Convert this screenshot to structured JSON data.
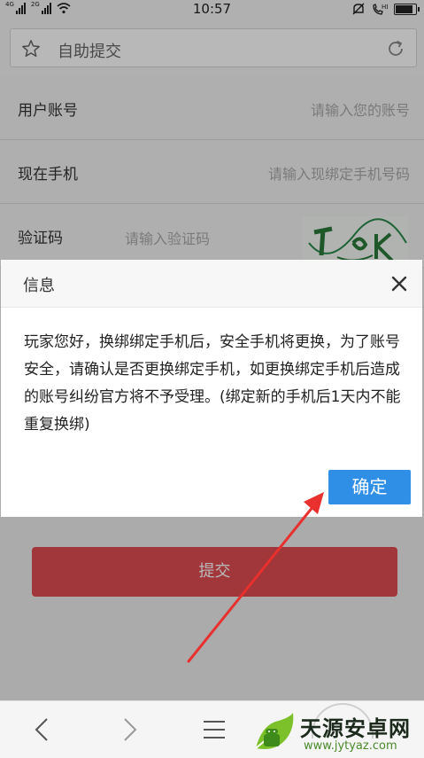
{
  "status_bar": {
    "signal_1": "4G",
    "signal_2": "2G",
    "time": "10:57",
    "battery_level": 0.85
  },
  "address_bar": {
    "title": "自助提交",
    "star_icon": "star-icon",
    "reload_icon": "reload-icon"
  },
  "form": {
    "rows": [
      {
        "label": "用户账号",
        "placeholder": "请输入您的账号"
      },
      {
        "label": "现在手机",
        "placeholder": "请输入现绑定手机号码"
      },
      {
        "label": "验证码",
        "placeholder": "请输入验证码"
      }
    ],
    "submit_label": "提交"
  },
  "dialog": {
    "title": "信息",
    "message": "玩家您好，换绑绑定手机后，安全手机将更换，为了账号安全，请确认是否更换绑定手机，如更换绑定手机后造成的账号纠纷官方将不予受理。(绑定新的手机后1天内不能重复换绑)",
    "ok_label": "确定"
  },
  "annotation": {
    "arrow_color": "#e8302e"
  },
  "navbar": {
    "back_icon": "chevron-left-icon",
    "forward_icon": "chevron-right-icon",
    "menu_icon": "hamburger-menu-icon"
  },
  "watermark": {
    "title": "天源安卓网",
    "url": "www.jytyaz.com"
  },
  "colors": {
    "submit": "#e04d52",
    "ok": "#2f8fe6",
    "overlay": "rgba(0,0,0,0.28)"
  }
}
